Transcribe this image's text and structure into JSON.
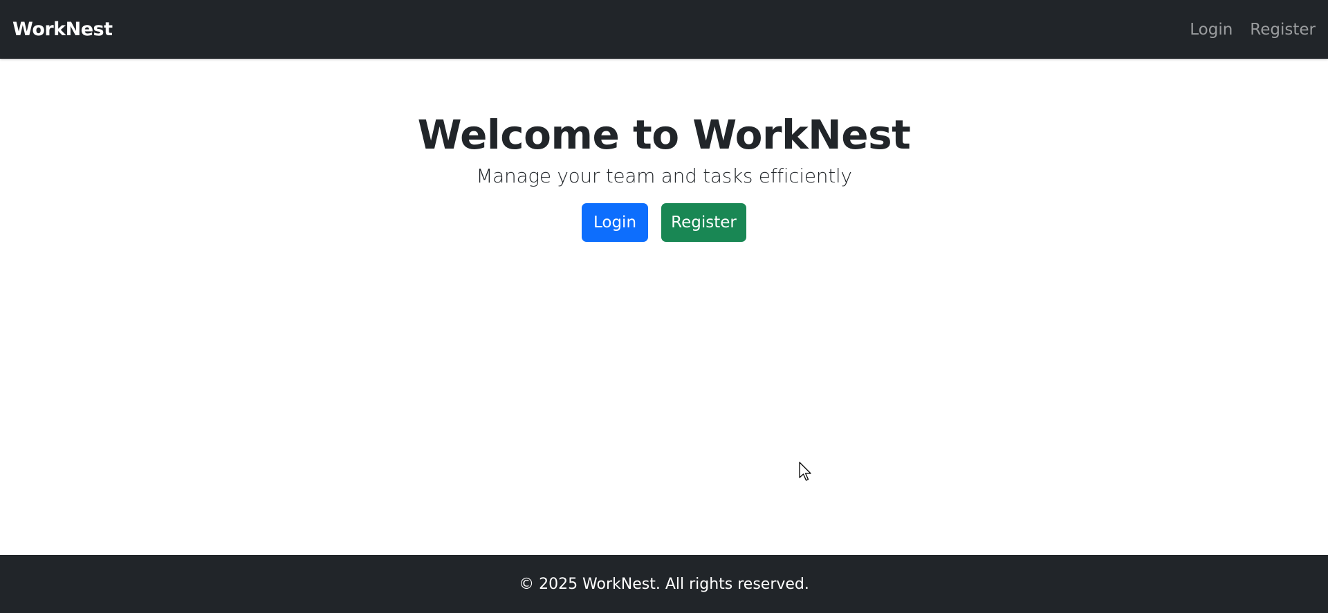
{
  "navbar": {
    "brand": "WorkNest",
    "links": [
      {
        "label": "Login"
      },
      {
        "label": "Register"
      }
    ]
  },
  "hero": {
    "title": "Welcome to WorkNest",
    "subtitle": "Manage your team and tasks efficiently",
    "buttons": {
      "login_label": "Login",
      "register_label": "Register"
    }
  },
  "footer": {
    "text": "© 2025 WorkNest. All rights reserved."
  },
  "colors": {
    "navbar_bg": "#212529",
    "primary": "#0d6efd",
    "success": "#198754",
    "text_dark": "#212529"
  },
  "icons": {
    "cursor": "mouse-pointer-icon"
  }
}
